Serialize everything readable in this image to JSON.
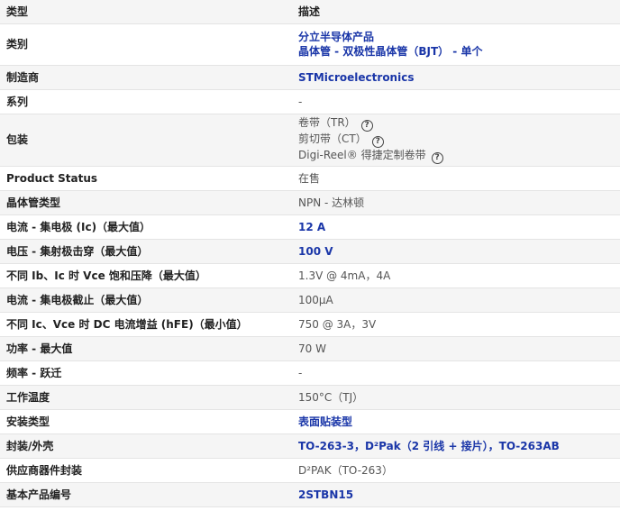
{
  "header": {
    "type_label": "类型",
    "desc_label": "描述"
  },
  "rows": {
    "category": {
      "label": "类别",
      "line1": "分立半导体产品",
      "line2": "晶体管 - 双极性晶体管（BJT） - 单个"
    },
    "manufacturer": {
      "label": "制造商",
      "value": "STMicroelectronics"
    },
    "series": {
      "label": "系列",
      "value": "-"
    },
    "packaging": {
      "label": "包装",
      "options": [
        "卷带（TR）",
        "剪切带（CT）",
        "Digi-Reel® 得捷定制卷带"
      ],
      "help_symbol": "?"
    },
    "product_status": {
      "label": "Product Status",
      "value": "在售"
    },
    "transistor_type": {
      "label": "晶体管类型",
      "value": "NPN - 达林顿"
    },
    "ic_max": {
      "label": "电流 - 集电极 (Ic)（最大值）",
      "value": "12 A"
    },
    "vce_breakdown": {
      "label": "电压 - 集射极击穿（最大值）",
      "value": "100 V"
    },
    "vce_sat": {
      "label": "不同 Ib、Ic 时 Vce 饱和压降（最大值）",
      "value": "1.3V @ 4mA，4A"
    },
    "icbo": {
      "label": "电流 - 集电极截止（最大值）",
      "value": "100µA"
    },
    "hfe": {
      "label": "不同 Ic、Vce 时 DC 电流增益 (hFE)（最小值）",
      "value": "750 @ 3A，3V"
    },
    "power_max": {
      "label": "功率 - 最大值",
      "value": "70 W"
    },
    "freq_transition": {
      "label": "频率 - 跃迁",
      "value": "-"
    },
    "op_temp": {
      "label": "工作温度",
      "value": "150°C（TJ）"
    },
    "mount_type": {
      "label": "安装类型",
      "value": "表面贴装型"
    },
    "package_case": {
      "label": "封装/外壳",
      "value": "TO-263-3，D²Pak（2 引线 + 接片），TO-263AB"
    },
    "supplier_pkg": {
      "label": "供应商器件封装",
      "value": "D²PAK（TO-263）"
    },
    "base_part": {
      "label": "基本产品编号",
      "value": "2STBN15"
    }
  }
}
